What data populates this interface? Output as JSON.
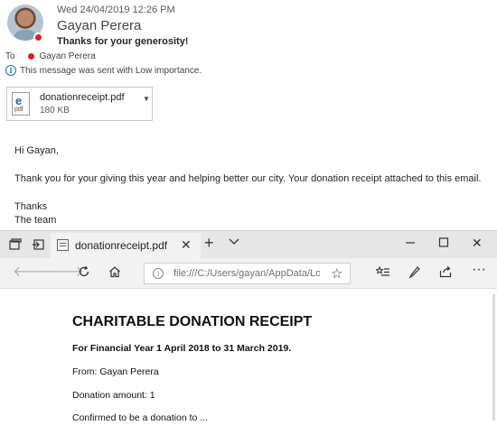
{
  "message": {
    "date": "Wed 24/04/2019 12:26 PM",
    "sender": "Gayan Perera",
    "subject": "Thanks for your generosity!",
    "to_label": "To",
    "recipient": "Gayan Perera",
    "importance_note": "This message was sent with Low importance.",
    "attachment": {
      "name": "donationreceipt.pdf",
      "size": "180 KB",
      "icon_letter": "e",
      "icon_type": "pdf"
    },
    "body": [
      "Hi Gayan,",
      "Thank you for your giving this year and helping better our city. Your donation receipt attached to this email.",
      "Thanks",
      "The team"
    ],
    "presence_color": "#e0201c"
  },
  "browser": {
    "tab_title": "donationreceipt.pdf",
    "address": "file:///C:/Users/gayan/AppData/Loc",
    "document": {
      "title": "CHARITABLE DONATION RECEIPT",
      "financial_year": "For Financial Year 1 April 2018 to 31 March 2019.",
      "from": "From: Gayan Perera",
      "amount": "Donation amount: 1",
      "confirmed": "Confirmed to be a donation to ..."
    }
  }
}
